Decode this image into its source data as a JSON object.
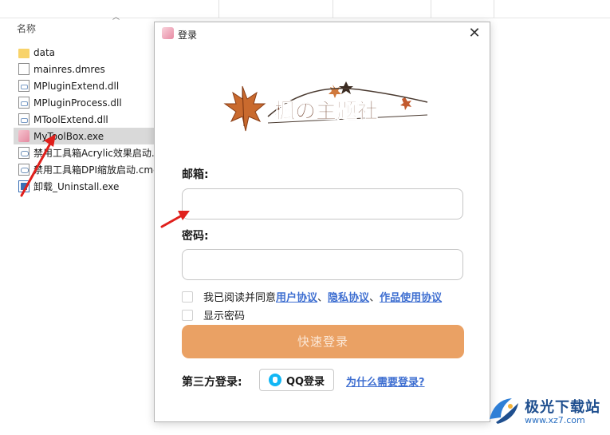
{
  "explorer": {
    "column_name": "名称",
    "files": [
      {
        "name": "data",
        "icon": "folder-icon"
      },
      {
        "name": "mainres.dmres",
        "icon": "document-icon"
      },
      {
        "name": "MPluginExtend.dll",
        "icon": "dll-file-icon"
      },
      {
        "name": "MPluginProcess.dll",
        "icon": "dll-file-icon"
      },
      {
        "name": "MToolExtend.dll",
        "icon": "dll-file-icon"
      },
      {
        "name": "MyToolBox.exe",
        "icon": "app-exe-icon",
        "selected": true
      },
      {
        "name": "禁用工具箱Acrylic效果启动.cmd",
        "icon": "cmd-script-icon"
      },
      {
        "name": "禁用工具箱DPI缩放启动.cmd",
        "icon": "cmd-script-icon"
      },
      {
        "name": "卸载_Uninstall.exe",
        "icon": "uninstall-icon"
      }
    ]
  },
  "login": {
    "title": "登录",
    "logo_text": "楓の主题社",
    "email_label": "邮箱:",
    "email_value": "",
    "password_label": "密码:",
    "password_value": "",
    "agree_prefix": "我已阅读并同意",
    "link_user_agreement": "用户协议",
    "separator1": "、",
    "link_privacy": "隐私协议",
    "separator2": "、",
    "link_works_agreement": "作品使用协议",
    "show_password": "显示密码",
    "login_button": "快速登录",
    "third_party_label": "第三方登录:",
    "qq_button": "QQ登录",
    "why_login": "为什么需要登录?"
  },
  "watermark": {
    "title": "极光下载站",
    "url": "www.xz7.com"
  },
  "colors": {
    "login_button": "#eaa164",
    "link": "#3f6fd1",
    "arrow": "#e0201c",
    "selected_row": "#d9d9d9"
  }
}
